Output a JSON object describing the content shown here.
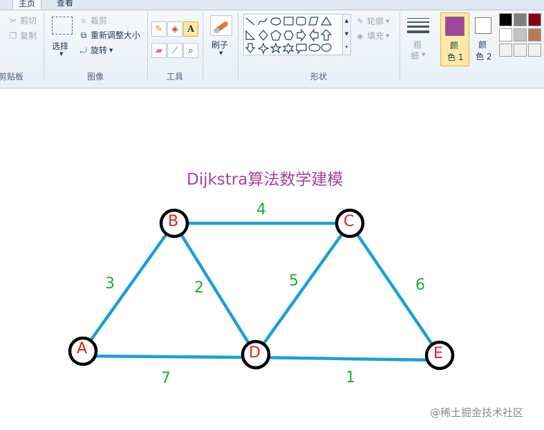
{
  "ribbon": {
    "tabs": [
      {
        "label": "主页",
        "active": true
      },
      {
        "label": "查看",
        "active": false
      }
    ],
    "clipboard": {
      "cut": "剪切",
      "copy": "复制",
      "group_label": "剪贴板"
    },
    "image": {
      "select": "选择",
      "crop": "裁剪",
      "resize": "重新调整大小",
      "rotate": "旋转",
      "group_label": "图像"
    },
    "tools": {
      "group_label": "工具"
    },
    "brush": {
      "label": "刷子"
    },
    "shapes": {
      "outline": "轮廓",
      "fill": "填充",
      "group_label": "形状"
    },
    "size": {
      "label_top": "粗",
      "label_bottom": "细"
    },
    "color1": {
      "label_top": "颜",
      "label_bottom": "色 1",
      "value": "#a3449d"
    },
    "color2": {
      "label_top": "颜",
      "label_bottom": "色 2",
      "value": "#ffffff"
    },
    "palette": [
      "#000000",
      "#7f7f7f",
      "#880015",
      "#ffffff",
      "#c3c3c3",
      "#b97a57",
      "#f0f0f0",
      "#f0f0f0",
      "#f0f0f0"
    ]
  },
  "canvas": {
    "title": "Dijkstra算法数学建模",
    "title_color": "#a3449d",
    "edge_color": "#1a9fd9",
    "node_label_color": "#e0201e",
    "weight_color": "#22a93b",
    "nodes": [
      "A",
      "B",
      "C",
      "D",
      "E"
    ],
    "weights": [
      "3",
      "2",
      "4",
      "5",
      "6",
      "7",
      "1"
    ],
    "watermark": "@稀土掘金技术社区"
  }
}
